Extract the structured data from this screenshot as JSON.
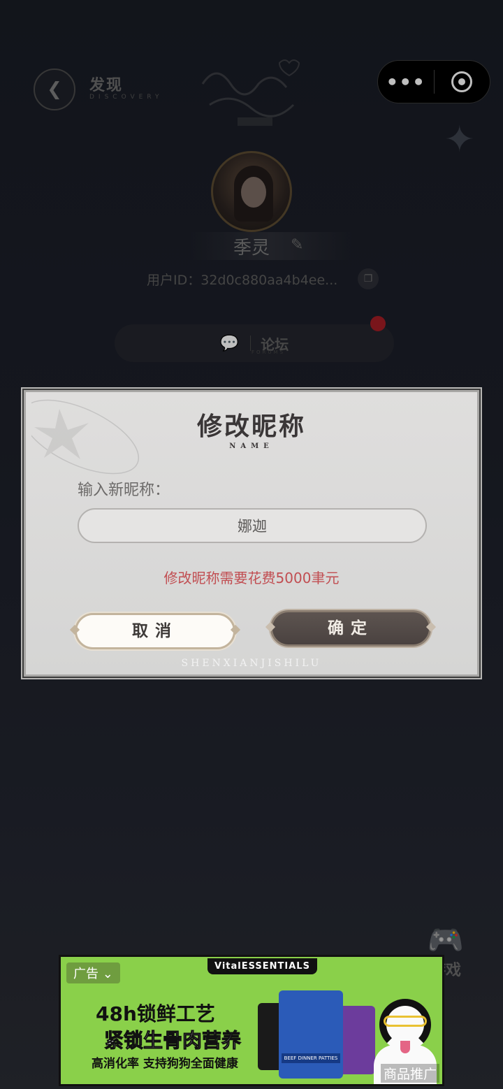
{
  "nav": {
    "title": "发现",
    "subtitle": "DISCOVERY"
  },
  "capsule": {
    "more_glyph": "•••"
  },
  "profile": {
    "username": "季灵",
    "user_id": "用户ID：32d0c880aa4b4ee..."
  },
  "menu": {
    "items": [
      {
        "label": "论坛",
        "sub": "FORUMS"
      }
    ]
  },
  "game": {
    "label": "游戏"
  },
  "modal": {
    "title": "修改昵称",
    "subtitle": "NAME",
    "field_label": "输入新昵称：",
    "nickname_value": "娜迦",
    "cost_note": "修改昵称需要花费5000聿元",
    "cancel_label": "取消",
    "confirm_label": "确定",
    "footer": "SHENXIANJISHILU"
  },
  "ad": {
    "tag": "广告 ⌄",
    "brand": "VitalESSENTIALS",
    "line1": "48h锁鲜工艺",
    "line2": "紧锁生骨肉营养",
    "line3": "高消化率 支持狗狗全面健康",
    "product_label": "BEEF DINNER PATTIES",
    "promo": "商品推广"
  },
  "colors": {
    "cost_note": "#c14e52",
    "confirm_bg": "#4a4240",
    "ad_bg": "#8ad04a",
    "badge": "#a21d25"
  }
}
